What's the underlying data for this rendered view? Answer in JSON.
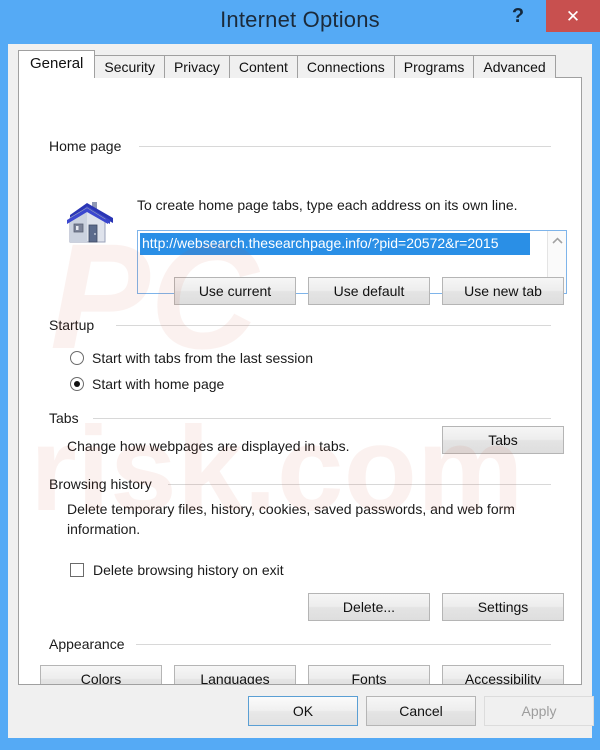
{
  "window": {
    "title": "Internet Options",
    "help_label": "?",
    "close_label": "✕",
    "titlebar_color": "#55aaf5",
    "close_color": "#c8504f"
  },
  "tabs": [
    {
      "label": "General",
      "active": true
    },
    {
      "label": "Security",
      "active": false
    },
    {
      "label": "Privacy",
      "active": false
    },
    {
      "label": "Content",
      "active": false
    },
    {
      "label": "Connections",
      "active": false
    },
    {
      "label": "Programs",
      "active": false
    },
    {
      "label": "Advanced",
      "active": false
    }
  ],
  "home_page": {
    "group_label": "Home page",
    "description": "To create home page tabs, type each address on its own line.",
    "url_value": "http://websearch.thesearchpage.info/?pid=20572&r=2015",
    "url_selected": true,
    "selection_color": "#2a8fe6",
    "icon": "house-icon",
    "scroll_up": "ⱏ",
    "scroll_down": "ⱟ",
    "buttons": [
      {
        "label": "Use current"
      },
      {
        "label": "Use default"
      },
      {
        "label": "Use new tab"
      }
    ]
  },
  "startup": {
    "group_label": "Startup",
    "options": [
      {
        "label": "Start with tabs from the last session",
        "checked": false
      },
      {
        "label": "Start with home page",
        "checked": true
      }
    ]
  },
  "tabs_section": {
    "group_label": "Tabs",
    "description": "Change how webpages are displayed in tabs.",
    "button_label": "Tabs"
  },
  "browsing_history": {
    "group_label": "Browsing history",
    "description": "Delete temporary files, history, cookies, saved passwords, and web form information.",
    "checkbox_label": "Delete browsing history on exit",
    "checkbox_checked": false,
    "buttons": [
      {
        "label": "Delete..."
      },
      {
        "label": "Settings"
      }
    ]
  },
  "appearance": {
    "group_label": "Appearance",
    "buttons": [
      {
        "label": "Colors"
      },
      {
        "label": "Languages"
      },
      {
        "label": "Fonts"
      },
      {
        "label": "Accessibility"
      }
    ]
  },
  "footer": {
    "ok_label": "OK",
    "cancel_label": "Cancel",
    "apply_label": "Apply",
    "apply_disabled": true
  },
  "watermark": {
    "line1": "PC",
    "line2": "risk.com"
  }
}
